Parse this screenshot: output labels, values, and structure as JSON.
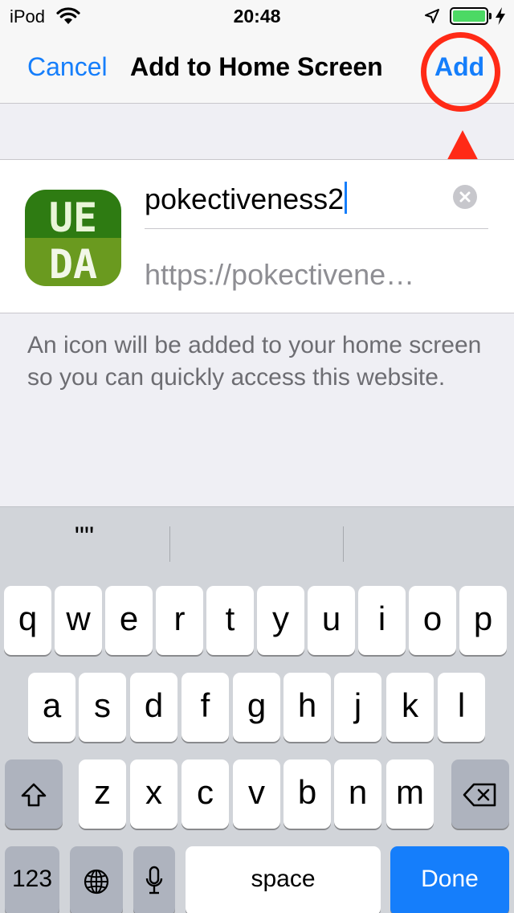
{
  "status_bar": {
    "carrier": "iPod",
    "time": "20:48",
    "battery_level": 1.0,
    "battery_color": "#4cd964",
    "icons": [
      "wifi-icon",
      "location-arrow-icon",
      "battery-icon",
      "charging-bolt-icon"
    ]
  },
  "nav": {
    "cancel_label": "Cancel",
    "title": "Add to Home Screen",
    "add_label": "Add",
    "accent_color": "#157efb"
  },
  "annotation": {
    "color": "#ff2a16",
    "shapes": [
      "highlight-circle",
      "arrow"
    ]
  },
  "form": {
    "app_icon_text": [
      "UE",
      "DA"
    ],
    "name_value": "pokectiveness2",
    "url_value": "https://pokectivene…"
  },
  "description": "An icon will be added to your home screen so you can quickly access this website.",
  "keyboard": {
    "suggestions": [
      "\"\"",
      "",
      ""
    ],
    "row1": [
      "q",
      "w",
      "e",
      "r",
      "t",
      "y",
      "u",
      "i",
      "o",
      "p"
    ],
    "row2": [
      "a",
      "s",
      "d",
      "f",
      "g",
      "h",
      "j",
      "k",
      "l"
    ],
    "row3": [
      "z",
      "x",
      "c",
      "v",
      "b",
      "n",
      "m"
    ],
    "numbers_label": "123",
    "space_label": "space",
    "done_label": "Done",
    "done_color": "#157efb"
  }
}
